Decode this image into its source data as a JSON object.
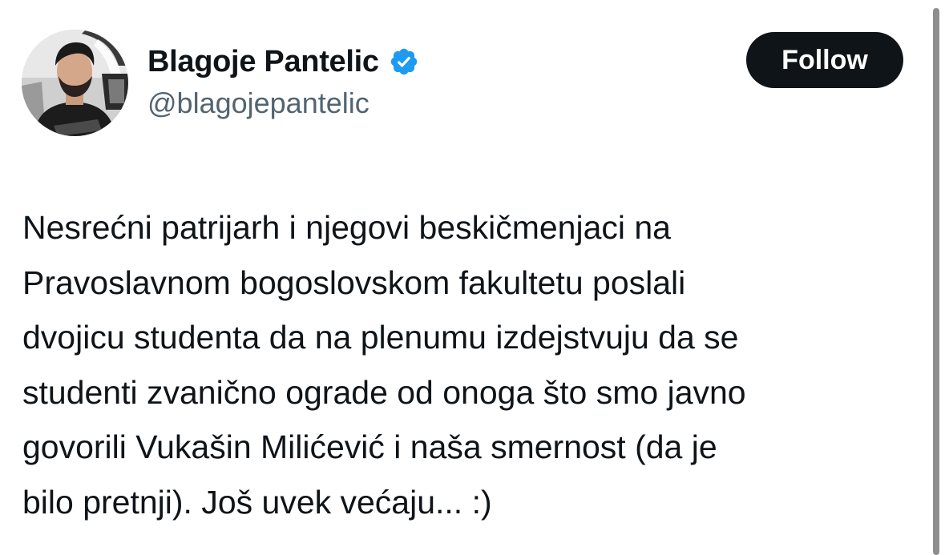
{
  "author": {
    "display_name": "Blagoje Pantelic",
    "handle": "@blagojepantelic",
    "verified": true,
    "avatar_icon": "profile-photo"
  },
  "follow_button": {
    "label": "Follow"
  },
  "tweet": {
    "text_lines": [
      "Nesrećni patrijarh i njegovi beskičmenjaci na",
      "Pravoslavnom bogoslovskom fakultetu poslali",
      "dvojicu studenta da na plenumu izdejstvuju da se",
      "studenti zvanično ograde od onoga što smo javno",
      "govorili Vukašin Milićević i naša smernost (da je",
      "bilo pretnji). Još uvek većaju... :)"
    ]
  },
  "colors": {
    "text_primary": "#0f1419",
    "text_secondary": "#536471",
    "verified_blue": "#1d9bf0",
    "button_bg": "#0f1419",
    "button_text": "#ffffff",
    "scrollbar": "#8e8e8e"
  }
}
